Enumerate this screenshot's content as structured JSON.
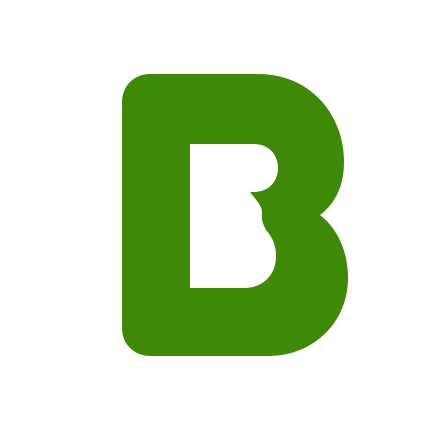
{
  "app_icon": {
    "icon": "letter-b-logo-icon",
    "letter": "B",
    "colors": {
      "background": "#ffffff",
      "glyph": "#3f8908"
    }
  }
}
